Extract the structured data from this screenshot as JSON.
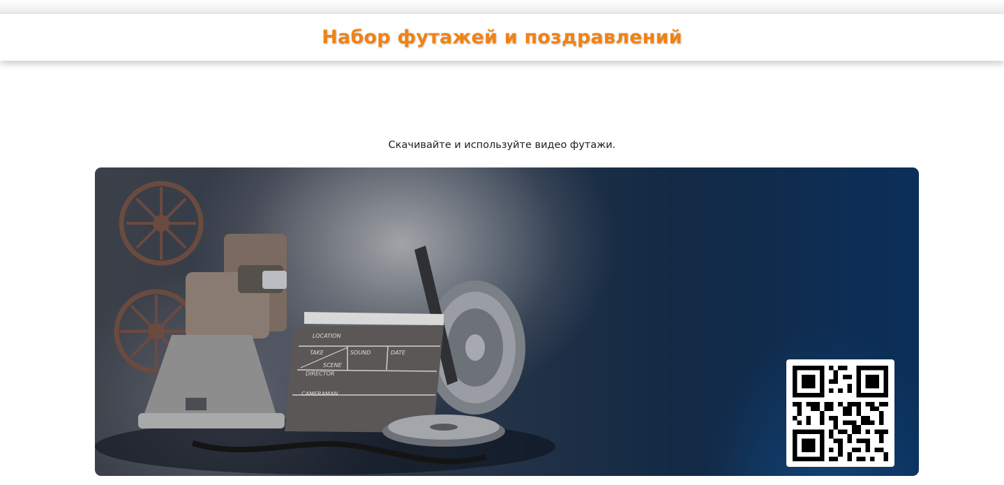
{
  "header": {
    "title": "Набор футажей и поздравлений"
  },
  "main": {
    "subtitle": "Скачивайте и используйте видео футажи."
  },
  "banner": {
    "clapper_labels": {
      "location": "LOCATION",
      "take": "TAKE",
      "scene": "SCENE",
      "sound": "SOUND",
      "date": "DATE",
      "director": "DIRECTOR",
      "cameraman": "CAMERAMAN"
    },
    "qr_code_icon": "qr-code-icon"
  },
  "colors": {
    "title_orange": "#f08214",
    "banner_blue": "#0b2f59"
  }
}
